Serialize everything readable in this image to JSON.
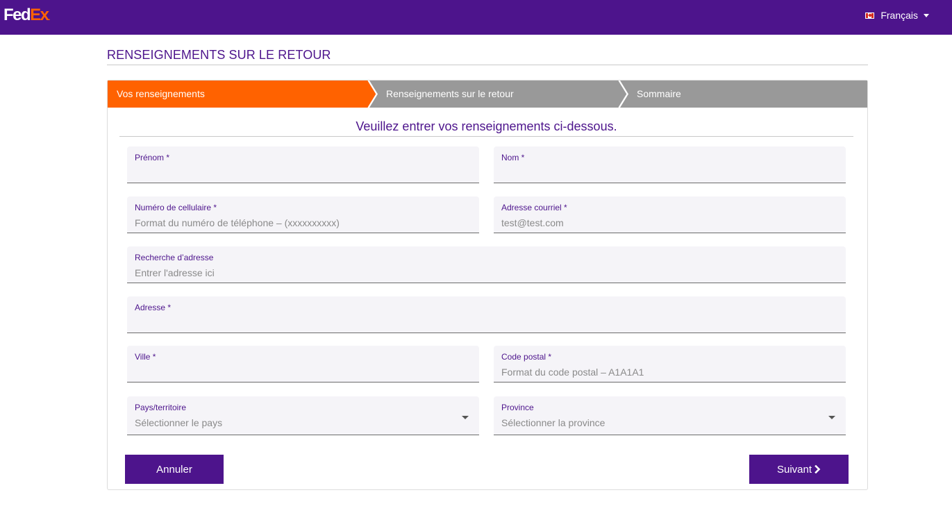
{
  "header": {
    "logo_part1": "Fed",
    "logo_part2": "Ex",
    "logo_dot": ".",
    "language_label": "Français",
    "flag_icon": "canada-flag-icon",
    "brand_color": "#4d148c",
    "accent_color": "#ff6200"
  },
  "page": {
    "title": "RENSEIGNEMENTS SUR LE RETOUR"
  },
  "stepper": {
    "steps": [
      {
        "label": "Vos renseignements",
        "active": true
      },
      {
        "label": "Renseignements sur le retour",
        "active": false
      },
      {
        "label": "Sommaire",
        "active": false
      }
    ],
    "active_color": "#ff6200",
    "inactive_color": "#999999"
  },
  "form": {
    "subtitle": "Veuillez entrer vos renseignements ci-dessous.",
    "first_name": {
      "label": "Prénom *",
      "placeholder": ""
    },
    "last_name": {
      "label": "Nom *",
      "placeholder": ""
    },
    "mobile": {
      "label": "Numéro de cellulaire *",
      "placeholder": "Format du numéro de téléphone – (xxxxxxxxxx)"
    },
    "email": {
      "label": "Adresse courriel *",
      "placeholder": "test@test.com"
    },
    "address_search": {
      "label": "Recherche d’adresse",
      "placeholder": "Entrer l'adresse ici"
    },
    "address": {
      "label": "Adresse *",
      "placeholder": ""
    },
    "city": {
      "label": "Ville *",
      "placeholder": ""
    },
    "postal_code": {
      "label": "Code postal *",
      "placeholder": "Format du code postal – A1A1A1"
    },
    "country": {
      "label": "Pays/territoire",
      "placeholder": "Sélectionner le pays"
    },
    "province": {
      "label": "Province",
      "placeholder": "Sélectionner la province"
    }
  },
  "buttons": {
    "cancel": "Annuler",
    "next": "Suivant",
    "next_icon": "chevron-right-icon"
  }
}
